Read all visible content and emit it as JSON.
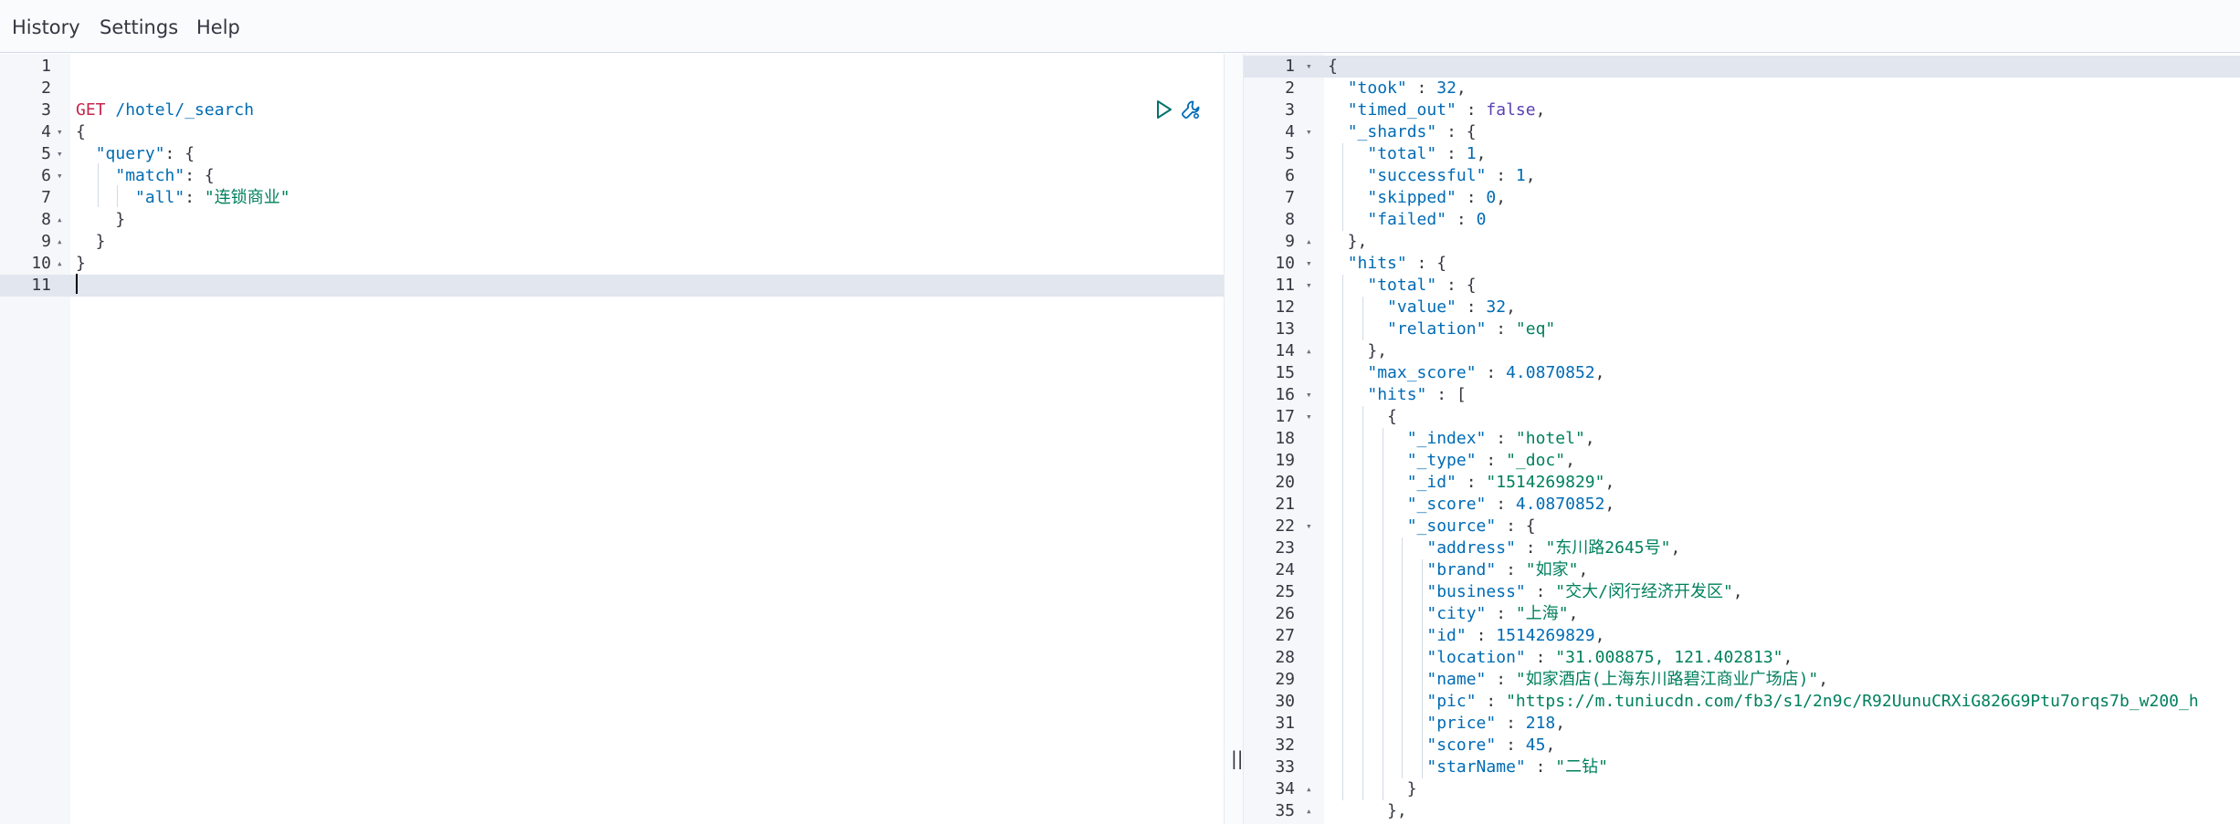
{
  "menu": {
    "history": "History",
    "settings": "Settings",
    "help": "Help"
  },
  "request": {
    "lines": [
      {
        "n": "1",
        "tokens": []
      },
      {
        "n": "2",
        "tokens": []
      },
      {
        "n": "3",
        "tokens": [
          [
            "GET",
            "method"
          ],
          [
            " /hotel/_search",
            "url"
          ]
        ]
      },
      {
        "n": "4",
        "fold": "open",
        "tokens": [
          [
            "{",
            "punc"
          ]
        ]
      },
      {
        "n": "5",
        "fold": "open",
        "tokens": [
          [
            "  ",
            "punc"
          ],
          [
            "\"query\"",
            "key"
          ],
          [
            ": {",
            "punc"
          ]
        ]
      },
      {
        "n": "6",
        "fold": "open",
        "tokens": [
          [
            "    ",
            "punc"
          ],
          [
            "\"match\"",
            "key"
          ],
          [
            ": {",
            "punc"
          ]
        ]
      },
      {
        "n": "7",
        "tokens": [
          [
            "      ",
            "punc"
          ],
          [
            "\"all\"",
            "key"
          ],
          [
            ": ",
            "punc"
          ],
          [
            "\"连锁商业\"",
            "str"
          ]
        ]
      },
      {
        "n": "8",
        "fold": "close",
        "tokens": [
          [
            "    }",
            "punc"
          ]
        ]
      },
      {
        "n": "9",
        "fold": "close",
        "tokens": [
          [
            "  }",
            "punc"
          ]
        ]
      },
      {
        "n": "10",
        "fold": "close",
        "tokens": [
          [
            "}",
            "punc"
          ]
        ]
      },
      {
        "n": "11",
        "active": true,
        "tokens": []
      }
    ],
    "action_icons": [
      "play-icon",
      "wrench-icon"
    ]
  },
  "response": {
    "lines": [
      {
        "n": "1",
        "fold": "open",
        "active": true,
        "tokens": [
          [
            "{",
            "punc"
          ]
        ]
      },
      {
        "n": "2",
        "tokens": [
          [
            "  ",
            "punc"
          ],
          [
            "\"took\"",
            "key"
          ],
          [
            " : ",
            "punc"
          ],
          [
            "32",
            "num"
          ],
          [
            ",",
            "punc"
          ]
        ]
      },
      {
        "n": "3",
        "tokens": [
          [
            "  ",
            "punc"
          ],
          [
            "\"timed_out\"",
            "key"
          ],
          [
            " : ",
            "punc"
          ],
          [
            "false",
            "bool"
          ],
          [
            ",",
            "punc"
          ]
        ]
      },
      {
        "n": "4",
        "fold": "open",
        "tokens": [
          [
            "  ",
            "punc"
          ],
          [
            "\"_shards\"",
            "key"
          ],
          [
            " : {",
            "punc"
          ]
        ]
      },
      {
        "n": "5",
        "tokens": [
          [
            "    ",
            "punc"
          ],
          [
            "\"total\"",
            "key"
          ],
          [
            " : ",
            "punc"
          ],
          [
            "1",
            "num"
          ],
          [
            ",",
            "punc"
          ]
        ]
      },
      {
        "n": "6",
        "tokens": [
          [
            "    ",
            "punc"
          ],
          [
            "\"successful\"",
            "key"
          ],
          [
            " : ",
            "punc"
          ],
          [
            "1",
            "num"
          ],
          [
            ",",
            "punc"
          ]
        ]
      },
      {
        "n": "7",
        "tokens": [
          [
            "    ",
            "punc"
          ],
          [
            "\"skipped\"",
            "key"
          ],
          [
            " : ",
            "punc"
          ],
          [
            "0",
            "num"
          ],
          [
            ",",
            "punc"
          ]
        ]
      },
      {
        "n": "8",
        "tokens": [
          [
            "    ",
            "punc"
          ],
          [
            "\"failed\"",
            "key"
          ],
          [
            " : ",
            "punc"
          ],
          [
            "0",
            "num"
          ]
        ]
      },
      {
        "n": "9",
        "fold": "close",
        "tokens": [
          [
            "  },",
            "punc"
          ]
        ]
      },
      {
        "n": "10",
        "fold": "open",
        "tokens": [
          [
            "  ",
            "punc"
          ],
          [
            "\"hits\"",
            "key"
          ],
          [
            " : {",
            "punc"
          ]
        ]
      },
      {
        "n": "11",
        "fold": "open",
        "tokens": [
          [
            "    ",
            "punc"
          ],
          [
            "\"total\"",
            "key"
          ],
          [
            " : {",
            "punc"
          ]
        ]
      },
      {
        "n": "12",
        "tokens": [
          [
            "      ",
            "punc"
          ],
          [
            "\"value\"",
            "key"
          ],
          [
            " : ",
            "punc"
          ],
          [
            "32",
            "num"
          ],
          [
            ",",
            "punc"
          ]
        ]
      },
      {
        "n": "13",
        "tokens": [
          [
            "      ",
            "punc"
          ],
          [
            "\"relation\"",
            "key"
          ],
          [
            " : ",
            "punc"
          ],
          [
            "\"eq\"",
            "str"
          ]
        ]
      },
      {
        "n": "14",
        "fold": "close",
        "tokens": [
          [
            "    },",
            "punc"
          ]
        ]
      },
      {
        "n": "15",
        "tokens": [
          [
            "    ",
            "punc"
          ],
          [
            "\"max_score\"",
            "key"
          ],
          [
            " : ",
            "punc"
          ],
          [
            "4.0870852",
            "num"
          ],
          [
            ",",
            "punc"
          ]
        ]
      },
      {
        "n": "16",
        "fold": "open",
        "tokens": [
          [
            "    ",
            "punc"
          ],
          [
            "\"hits\"",
            "key"
          ],
          [
            " : [",
            "punc"
          ]
        ]
      },
      {
        "n": "17",
        "fold": "open",
        "tokens": [
          [
            "      {",
            "punc"
          ]
        ]
      },
      {
        "n": "18",
        "tokens": [
          [
            "        ",
            "punc"
          ],
          [
            "\"_index\"",
            "key"
          ],
          [
            " : ",
            "punc"
          ],
          [
            "\"hotel\"",
            "str"
          ],
          [
            ",",
            "punc"
          ]
        ]
      },
      {
        "n": "19",
        "tokens": [
          [
            "        ",
            "punc"
          ],
          [
            "\"_type\"",
            "key"
          ],
          [
            " : ",
            "punc"
          ],
          [
            "\"_doc\"",
            "str"
          ],
          [
            ",",
            "punc"
          ]
        ]
      },
      {
        "n": "20",
        "tokens": [
          [
            "        ",
            "punc"
          ],
          [
            "\"_id\"",
            "key"
          ],
          [
            " : ",
            "punc"
          ],
          [
            "\"1514269829\"",
            "str"
          ],
          [
            ",",
            "punc"
          ]
        ]
      },
      {
        "n": "21",
        "tokens": [
          [
            "        ",
            "punc"
          ],
          [
            "\"_score\"",
            "key"
          ],
          [
            " : ",
            "punc"
          ],
          [
            "4.0870852",
            "num"
          ],
          [
            ",",
            "punc"
          ]
        ]
      },
      {
        "n": "22",
        "fold": "open",
        "tokens": [
          [
            "        ",
            "punc"
          ],
          [
            "\"_source\"",
            "key"
          ],
          [
            " : {",
            "punc"
          ]
        ]
      },
      {
        "n": "23",
        "tokens": [
          [
            "          ",
            "punc"
          ],
          [
            "\"address\"",
            "key"
          ],
          [
            " : ",
            "punc"
          ],
          [
            "\"东川路2645号\"",
            "str"
          ],
          [
            ",",
            "punc"
          ]
        ]
      },
      {
        "n": "24",
        "tokens": [
          [
            "          ",
            "punc"
          ],
          [
            "\"brand\"",
            "key"
          ],
          [
            " : ",
            "punc"
          ],
          [
            "\"如家\"",
            "str"
          ],
          [
            ",",
            "punc"
          ]
        ]
      },
      {
        "n": "25",
        "tokens": [
          [
            "          ",
            "punc"
          ],
          [
            "\"business\"",
            "key"
          ],
          [
            " : ",
            "punc"
          ],
          [
            "\"交大/闵行经济开发区\"",
            "str"
          ],
          [
            ",",
            "punc"
          ]
        ]
      },
      {
        "n": "26",
        "tokens": [
          [
            "          ",
            "punc"
          ],
          [
            "\"city\"",
            "key"
          ],
          [
            " : ",
            "punc"
          ],
          [
            "\"上海\"",
            "str"
          ],
          [
            ",",
            "punc"
          ]
        ]
      },
      {
        "n": "27",
        "tokens": [
          [
            "          ",
            "punc"
          ],
          [
            "\"id\"",
            "key"
          ],
          [
            " : ",
            "punc"
          ],
          [
            "1514269829",
            "num"
          ],
          [
            ",",
            "punc"
          ]
        ]
      },
      {
        "n": "28",
        "tokens": [
          [
            "          ",
            "punc"
          ],
          [
            "\"location\"",
            "key"
          ],
          [
            " : ",
            "punc"
          ],
          [
            "\"31.008875, 121.402813\"",
            "str"
          ],
          [
            ",",
            "punc"
          ]
        ]
      },
      {
        "n": "29",
        "tokens": [
          [
            "          ",
            "punc"
          ],
          [
            "\"name\"",
            "key"
          ],
          [
            " : ",
            "punc"
          ],
          [
            "\"如家酒店(上海东川路碧江商业广场店)\"",
            "str"
          ],
          [
            ",",
            "punc"
          ]
        ]
      },
      {
        "n": "30",
        "tokens": [
          [
            "          ",
            "punc"
          ],
          [
            "\"pic\"",
            "key"
          ],
          [
            " : ",
            "punc"
          ],
          [
            "\"https://m.tuniucdn.com/fb3/s1/2n9c/R92UunuCRXiG826G9Ptu7orqs7b_w200_h",
            "str"
          ]
        ]
      },
      {
        "n": "31",
        "tokens": [
          [
            "          ",
            "punc"
          ],
          [
            "\"price\"",
            "key"
          ],
          [
            " : ",
            "punc"
          ],
          [
            "218",
            "num"
          ],
          [
            ",",
            "punc"
          ]
        ]
      },
      {
        "n": "32",
        "tokens": [
          [
            "          ",
            "punc"
          ],
          [
            "\"score\"",
            "key"
          ],
          [
            " : ",
            "punc"
          ],
          [
            "45",
            "num"
          ],
          [
            ",",
            "punc"
          ]
        ]
      },
      {
        "n": "33",
        "tokens": [
          [
            "          ",
            "punc"
          ],
          [
            "\"starName\"",
            "key"
          ],
          [
            " : ",
            "punc"
          ],
          [
            "\"二钻\"",
            "str"
          ]
        ]
      },
      {
        "n": "34",
        "fold": "close",
        "tokens": [
          [
            "        }",
            "punc"
          ]
        ]
      },
      {
        "n": "35",
        "fold": "close",
        "tokens": [
          [
            "      },",
            "punc"
          ]
        ]
      }
    ]
  },
  "splitter_grip": "||",
  "colors": {
    "method": "#c7254e",
    "key": "#006bb4",
    "string": "#00805c",
    "number": "#006bb4",
    "boolean": "#5a42b2",
    "active_line": "#e1e6ef"
  }
}
